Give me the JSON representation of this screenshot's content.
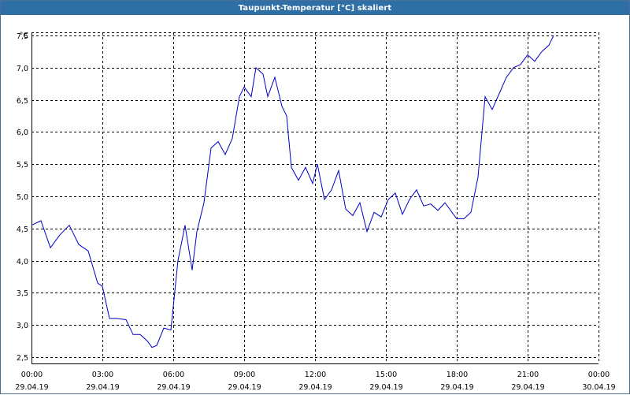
{
  "window": {
    "title": "Taupunkt-Temperatur [°C] skaliert"
  },
  "colors": {
    "titlebar": "#2e6fa6",
    "line": "#0000c8",
    "grid": "#000000",
    "background": "#ffffff"
  },
  "chart_data": {
    "type": "line",
    "title": "Taupunkt-Temperatur [°C] skaliert",
    "ylabel": "°C",
    "xlabel": "",
    "ylim": [
      2.4,
      7.55
    ],
    "xlim_hours": [
      0,
      24
    ],
    "grid": true,
    "y_ticks": [
      {
        "value": 2.5,
        "label": "2,5"
      },
      {
        "value": 3.0,
        "label": "3,0"
      },
      {
        "value": 3.5,
        "label": "3,5"
      },
      {
        "value": 4.0,
        "label": "4,0"
      },
      {
        "value": 4.5,
        "label": "4,5"
      },
      {
        "value": 5.0,
        "label": "5,0"
      },
      {
        "value": 5.5,
        "label": "5,5"
      },
      {
        "value": 6.0,
        "label": "6,0"
      },
      {
        "value": 6.5,
        "label": "6,5"
      },
      {
        "value": 7.0,
        "label": "7,0"
      },
      {
        "value": 7.5,
        "label": "7,5"
      }
    ],
    "x_ticks": [
      {
        "time": "00:00",
        "date": "29.04.19",
        "hour": 0
      },
      {
        "time": "03:00",
        "date": "29.04.19",
        "hour": 3
      },
      {
        "time": "06:00",
        "date": "29.04.19",
        "hour": 6
      },
      {
        "time": "09:00",
        "date": "29.04.19",
        "hour": 9
      },
      {
        "time": "12:00",
        "date": "29.04.19",
        "hour": 12
      },
      {
        "time": "15:00",
        "date": "29.04.19",
        "hour": 15
      },
      {
        "time": "18:00",
        "date": "29.04.19",
        "hour": 18
      },
      {
        "time": "21:00",
        "date": "29.04.19",
        "hour": 21
      },
      {
        "time": "00:00",
        "date": "30.04.19",
        "hour": 24
      }
    ],
    "series": [
      {
        "x_hours": [
          0.0,
          0.4,
          0.8,
          1.2,
          1.6,
          2.0,
          2.4,
          2.8,
          3.0,
          3.3,
          3.6,
          4.0,
          4.3,
          4.6,
          4.9,
          5.1,
          5.3,
          5.6,
          5.9,
          6.2,
          6.5,
          6.8,
          7.0,
          7.3,
          7.6,
          7.9,
          8.2,
          8.5,
          8.8,
          9.0,
          9.3,
          9.5,
          9.8,
          10.0,
          10.3,
          10.6,
          10.8,
          11.0,
          11.3,
          11.6,
          11.9,
          12.1,
          12.4,
          12.7,
          13.0,
          13.3,
          13.6,
          13.9,
          14.2,
          14.5,
          14.8,
          15.1,
          15.4,
          15.7,
          16.0,
          16.3,
          16.6,
          16.9,
          17.2,
          17.5,
          17.8,
          18.0,
          18.3,
          18.6,
          18.9,
          19.2,
          19.5,
          19.8,
          20.1,
          20.4,
          20.7,
          21.0,
          21.3,
          21.6,
          21.9,
          22.1
        ],
        "values": [
          4.55,
          4.62,
          4.2,
          4.4,
          4.55,
          4.25,
          4.15,
          3.65,
          3.6,
          3.1,
          3.1,
          3.08,
          2.85,
          2.85,
          2.75,
          2.65,
          2.68,
          2.95,
          2.92,
          4.0,
          4.55,
          3.85,
          4.45,
          4.9,
          5.75,
          5.85,
          5.65,
          5.9,
          6.55,
          6.7,
          6.55,
          7.0,
          6.9,
          6.55,
          6.85,
          6.4,
          6.25,
          5.45,
          5.25,
          5.45,
          5.2,
          5.5,
          4.95,
          5.1,
          5.4,
          4.8,
          4.7,
          4.9,
          4.45,
          4.75,
          4.68,
          4.95,
          5.05,
          4.72,
          4.95,
          5.1,
          4.85,
          4.88,
          4.78,
          4.9,
          4.75,
          4.65,
          4.65,
          4.75,
          5.3,
          6.55,
          6.35,
          6.6,
          6.85,
          7.0,
          7.05,
          7.2,
          7.1,
          7.25,
          7.35,
          7.5
        ]
      }
    ]
  }
}
